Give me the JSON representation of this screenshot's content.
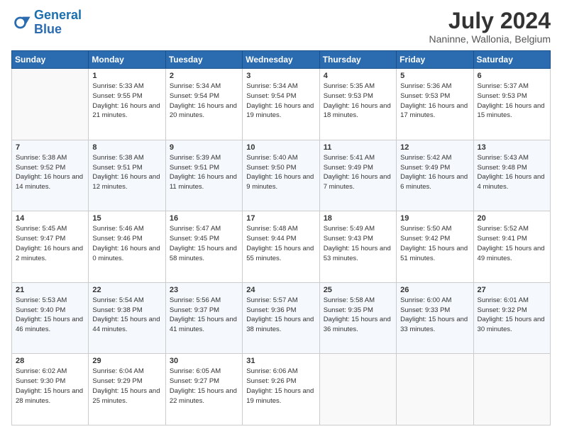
{
  "header": {
    "logo_line1": "General",
    "logo_line2": "Blue",
    "title": "July 2024",
    "subtitle": "Naninne, Wallonia, Belgium"
  },
  "calendar": {
    "days_of_week": [
      "Sunday",
      "Monday",
      "Tuesday",
      "Wednesday",
      "Thursday",
      "Friday",
      "Saturday"
    ],
    "weeks": [
      [
        {
          "day": "",
          "info": ""
        },
        {
          "day": "1",
          "info": "Sunrise: 5:33 AM\nSunset: 9:55 PM\nDaylight: 16 hours\nand 21 minutes."
        },
        {
          "day": "2",
          "info": "Sunrise: 5:34 AM\nSunset: 9:54 PM\nDaylight: 16 hours\nand 20 minutes."
        },
        {
          "day": "3",
          "info": "Sunrise: 5:34 AM\nSunset: 9:54 PM\nDaylight: 16 hours\nand 19 minutes."
        },
        {
          "day": "4",
          "info": "Sunrise: 5:35 AM\nSunset: 9:53 PM\nDaylight: 16 hours\nand 18 minutes."
        },
        {
          "day": "5",
          "info": "Sunrise: 5:36 AM\nSunset: 9:53 PM\nDaylight: 16 hours\nand 17 minutes."
        },
        {
          "day": "6",
          "info": "Sunrise: 5:37 AM\nSunset: 9:53 PM\nDaylight: 16 hours\nand 15 minutes."
        }
      ],
      [
        {
          "day": "7",
          "info": "Sunrise: 5:38 AM\nSunset: 9:52 PM\nDaylight: 16 hours\nand 14 minutes."
        },
        {
          "day": "8",
          "info": "Sunrise: 5:38 AM\nSunset: 9:51 PM\nDaylight: 16 hours\nand 12 minutes."
        },
        {
          "day": "9",
          "info": "Sunrise: 5:39 AM\nSunset: 9:51 PM\nDaylight: 16 hours\nand 11 minutes."
        },
        {
          "day": "10",
          "info": "Sunrise: 5:40 AM\nSunset: 9:50 PM\nDaylight: 16 hours\nand 9 minutes."
        },
        {
          "day": "11",
          "info": "Sunrise: 5:41 AM\nSunset: 9:49 PM\nDaylight: 16 hours\nand 7 minutes."
        },
        {
          "day": "12",
          "info": "Sunrise: 5:42 AM\nSunset: 9:49 PM\nDaylight: 16 hours\nand 6 minutes."
        },
        {
          "day": "13",
          "info": "Sunrise: 5:43 AM\nSunset: 9:48 PM\nDaylight: 16 hours\nand 4 minutes."
        }
      ],
      [
        {
          "day": "14",
          "info": "Sunrise: 5:45 AM\nSunset: 9:47 PM\nDaylight: 16 hours\nand 2 minutes."
        },
        {
          "day": "15",
          "info": "Sunrise: 5:46 AM\nSunset: 9:46 PM\nDaylight: 16 hours\nand 0 minutes."
        },
        {
          "day": "16",
          "info": "Sunrise: 5:47 AM\nSunset: 9:45 PM\nDaylight: 15 hours\nand 58 minutes."
        },
        {
          "day": "17",
          "info": "Sunrise: 5:48 AM\nSunset: 9:44 PM\nDaylight: 15 hours\nand 55 minutes."
        },
        {
          "day": "18",
          "info": "Sunrise: 5:49 AM\nSunset: 9:43 PM\nDaylight: 15 hours\nand 53 minutes."
        },
        {
          "day": "19",
          "info": "Sunrise: 5:50 AM\nSunset: 9:42 PM\nDaylight: 15 hours\nand 51 minutes."
        },
        {
          "day": "20",
          "info": "Sunrise: 5:52 AM\nSunset: 9:41 PM\nDaylight: 15 hours\nand 49 minutes."
        }
      ],
      [
        {
          "day": "21",
          "info": "Sunrise: 5:53 AM\nSunset: 9:40 PM\nDaylight: 15 hours\nand 46 minutes."
        },
        {
          "day": "22",
          "info": "Sunrise: 5:54 AM\nSunset: 9:38 PM\nDaylight: 15 hours\nand 44 minutes."
        },
        {
          "day": "23",
          "info": "Sunrise: 5:56 AM\nSunset: 9:37 PM\nDaylight: 15 hours\nand 41 minutes."
        },
        {
          "day": "24",
          "info": "Sunrise: 5:57 AM\nSunset: 9:36 PM\nDaylight: 15 hours\nand 38 minutes."
        },
        {
          "day": "25",
          "info": "Sunrise: 5:58 AM\nSunset: 9:35 PM\nDaylight: 15 hours\nand 36 minutes."
        },
        {
          "day": "26",
          "info": "Sunrise: 6:00 AM\nSunset: 9:33 PM\nDaylight: 15 hours\nand 33 minutes."
        },
        {
          "day": "27",
          "info": "Sunrise: 6:01 AM\nSunset: 9:32 PM\nDaylight: 15 hours\nand 30 minutes."
        }
      ],
      [
        {
          "day": "28",
          "info": "Sunrise: 6:02 AM\nSunset: 9:30 PM\nDaylight: 15 hours\nand 28 minutes."
        },
        {
          "day": "29",
          "info": "Sunrise: 6:04 AM\nSunset: 9:29 PM\nDaylight: 15 hours\nand 25 minutes."
        },
        {
          "day": "30",
          "info": "Sunrise: 6:05 AM\nSunset: 9:27 PM\nDaylight: 15 hours\nand 22 minutes."
        },
        {
          "day": "31",
          "info": "Sunrise: 6:06 AM\nSunset: 9:26 PM\nDaylight: 15 hours\nand 19 minutes."
        },
        {
          "day": "",
          "info": ""
        },
        {
          "day": "",
          "info": ""
        },
        {
          "day": "",
          "info": ""
        }
      ]
    ]
  }
}
